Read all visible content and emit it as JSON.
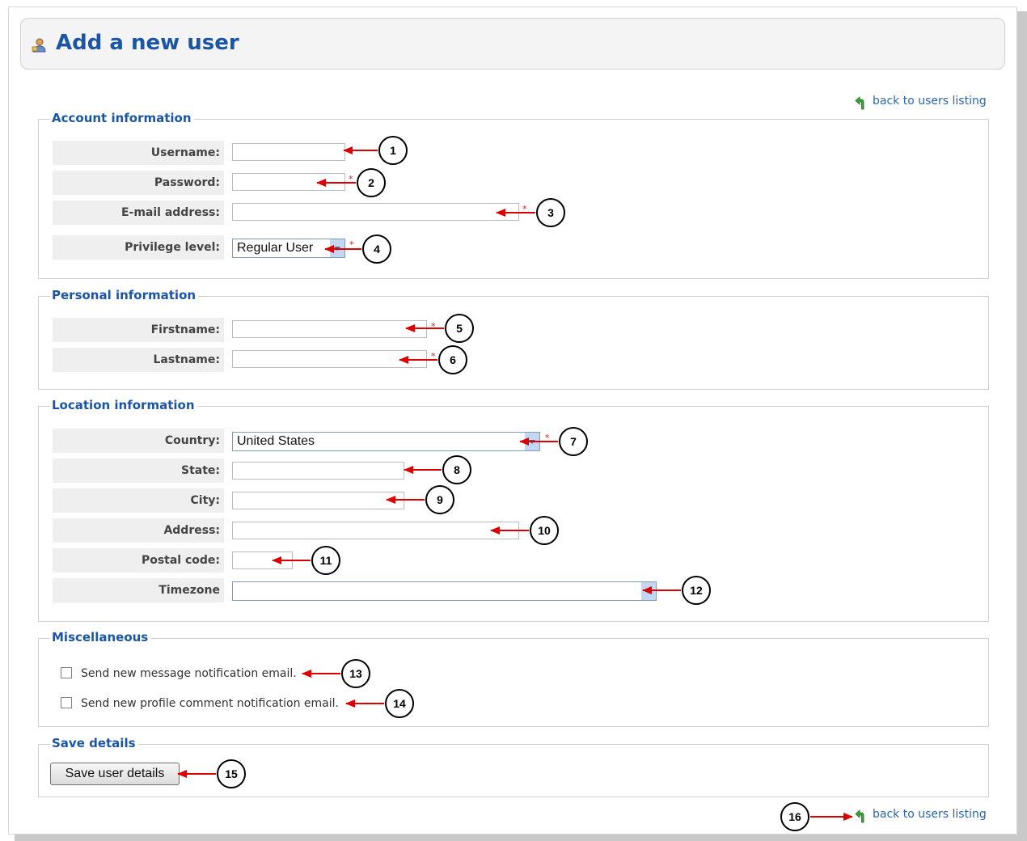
{
  "page": {
    "title": "Add a new user",
    "back_link": "back to users listing"
  },
  "account": {
    "legend": "Account information",
    "username_label": "Username:",
    "password_label": "Password:",
    "email_label": "E-mail address:",
    "privilege_label": "Privilege level:",
    "privilege_value": "Regular User"
  },
  "personal": {
    "legend": "Personal information",
    "firstname_label": "Firstname:",
    "lastname_label": "Lastname:"
  },
  "location": {
    "legend": "Location information",
    "country_label": "Country:",
    "country_value": "United States",
    "state_label": "State:",
    "city_label": "City:",
    "address_label": "Address:",
    "postal_label": "Postal code:",
    "timezone_label": "Timezone",
    "timezone_value": ""
  },
  "misc": {
    "legend": "Miscellaneous",
    "message_notification": "Send new message notification email.",
    "comment_notification": "Send new profile comment notification email."
  },
  "save": {
    "legend": "Save details",
    "button": "Save user details"
  },
  "required_marker": "*",
  "annotations": [
    "1",
    "2",
    "3",
    "4",
    "5",
    "6",
    "7",
    "8",
    "9",
    "10",
    "11",
    "12",
    "13",
    "14",
    "15",
    "16"
  ],
  "colors": {
    "heading": "#1b56a6",
    "link": "#2a66b0",
    "arrow": "#dd0000",
    "label_bg": "#efefef"
  },
  "icons": {
    "title": "user-icon",
    "back": "back-arrow-icon"
  }
}
